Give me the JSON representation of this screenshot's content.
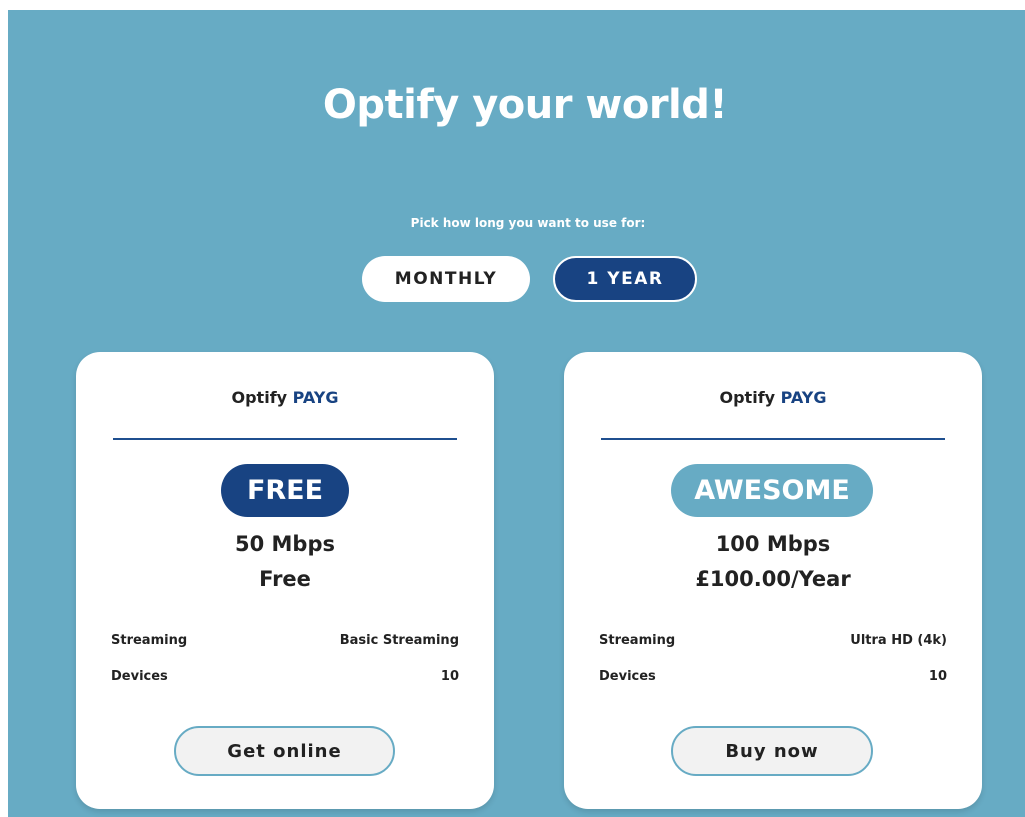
{
  "header": {
    "title": "Optify your world!",
    "subtitle": "Pick how long you want to use for:"
  },
  "duration_toggle": {
    "options": [
      {
        "label": "MONTHLY",
        "selected": false
      },
      {
        "label": "1 YEAR",
        "selected": true
      }
    ]
  },
  "plans": [
    {
      "brand": "Optify",
      "brand_accent": "PAYG",
      "badge": "FREE",
      "speed": "50 Mbps",
      "price": "Free",
      "features": [
        {
          "label": "Streaming",
          "value": "Basic Streaming"
        },
        {
          "label": "Devices",
          "value": "10"
        }
      ],
      "cta": "Get online"
    },
    {
      "brand": "Optify",
      "brand_accent": "PAYG",
      "badge": "AWESOME",
      "speed": "100 Mbps",
      "price": "£100.00/Year",
      "features": [
        {
          "label": "Streaming",
          "value": "Ultra HD (4k)"
        },
        {
          "label": "Devices",
          "value": "10"
        }
      ],
      "cta": "Buy now"
    }
  ],
  "colors": {
    "background": "#67abc4",
    "primary": "#184382",
    "card": "#ffffff",
    "button_bg": "#f2f2f2"
  }
}
